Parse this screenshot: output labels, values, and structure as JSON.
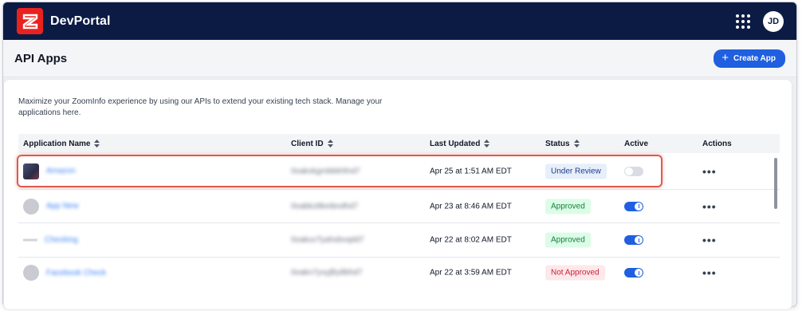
{
  "brand": {
    "name": "DevPortal"
  },
  "user": {
    "initials": "JD"
  },
  "page": {
    "title": "API Apps",
    "create_label": "Create App"
  },
  "intro": "Maximize your ZoomInfo experience by using our APIs to extend your existing tech stack. Manage your applications here.",
  "table": {
    "columns": {
      "name": "Application Name",
      "client_id": "Client ID",
      "updated": "Last Updated",
      "status": "Status",
      "active": "Active",
      "actions": "Actions"
    },
    "rows": [
      {
        "name": "Amazon",
        "client_id": "0oakxkgmbbkhfnd7",
        "updated": "Apr 25 at 1:51 AM EDT",
        "status": "Under Review",
        "active": false
      },
      {
        "name": "App New",
        "client_id": "0oabkz8keibndhd7",
        "updated": "Apr 23 at 8:46 AM EDT",
        "status": "Approved",
        "active": true
      },
      {
        "name": "Checking",
        "client_id": "0oakuvTyahsbvqdd7",
        "updated": "Apr 22 at 8:02 AM EDT",
        "status": "Approved",
        "active": true
      },
      {
        "name": "Facebook Check",
        "client_id": "0oakn7yxyjBy8bhd7",
        "updated": "Apr 22 at 3:59 AM EDT",
        "status": "Not Approved",
        "active": true
      }
    ]
  },
  "colors": {
    "nav": "#0b1b44",
    "brand": "#e8221f",
    "accent": "#1f5fe0"
  },
  "icons": {
    "apps": "apps-grid-icon",
    "sort": "sort-icon",
    "more": "more-dots-icon",
    "plus": "plus-icon"
  }
}
